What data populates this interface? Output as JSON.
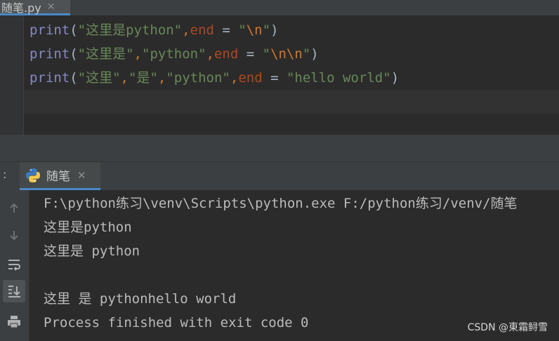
{
  "editor": {
    "tab": {
      "label": "随笔.py",
      "close": "✕"
    },
    "lines": [
      [
        {
          "t": "print",
          "c": "fn"
        },
        {
          "t": "(",
          "c": "p"
        },
        {
          "t": "\"这里是python\"",
          "c": "str"
        },
        {
          "t": ",",
          "c": "esc"
        },
        {
          "t": "end",
          "c": "kw"
        },
        {
          "t": " = ",
          "c": "op"
        },
        {
          "t": "\"",
          "c": "str"
        },
        {
          "t": "\\n",
          "c": "esc"
        },
        {
          "t": "\"",
          "c": "str"
        },
        {
          "t": ")",
          "c": "p"
        }
      ],
      [
        {
          "t": "print",
          "c": "fn"
        },
        {
          "t": "(",
          "c": "p"
        },
        {
          "t": "\"这里是\"",
          "c": "str"
        },
        {
          "t": ",",
          "c": "esc"
        },
        {
          "t": "\"python\"",
          "c": "str"
        },
        {
          "t": ",",
          "c": "esc"
        },
        {
          "t": "end",
          "c": "kw"
        },
        {
          "t": " = ",
          "c": "op"
        },
        {
          "t": "\"",
          "c": "str"
        },
        {
          "t": "\\n\\n",
          "c": "esc"
        },
        {
          "t": "\"",
          "c": "str"
        },
        {
          "t": ")",
          "c": "p"
        }
      ],
      [
        {
          "t": "print",
          "c": "fn"
        },
        {
          "t": "(",
          "c": "p"
        },
        {
          "t": "\"这里\"",
          "c": "str"
        },
        {
          "t": ",",
          "c": "esc"
        },
        {
          "t": "\"是\"",
          "c": "str"
        },
        {
          "t": ",",
          "c": "esc"
        },
        {
          "t": "\"python\"",
          "c": "str"
        },
        {
          "t": ",",
          "c": "esc"
        },
        {
          "t": "end",
          "c": "kw"
        },
        {
          "t": " = ",
          "c": "op"
        },
        {
          "t": "\"hello world\"",
          "c": "str"
        },
        {
          "t": ")",
          "c": "p"
        }
      ]
    ]
  },
  "run": {
    "header_dot": ":",
    "tab_label": "随笔",
    "tab_close": "✕",
    "sidebar_icons": [
      "up-arrow-icon",
      "down-arrow-icon",
      "soft-wrap-icon",
      "scroll-to-end-icon",
      "print-icon"
    ],
    "console_lines": [
      "F:\\python练习\\venv\\Scripts\\python.exe F:/python练习/venv/随笔",
      "这里是python",
      "这里是 python",
      "",
      "这里 是 pythonhello world",
      "Process finished with exit code 0"
    ]
  },
  "watermark": "CSDN @東霜鲟雪"
}
